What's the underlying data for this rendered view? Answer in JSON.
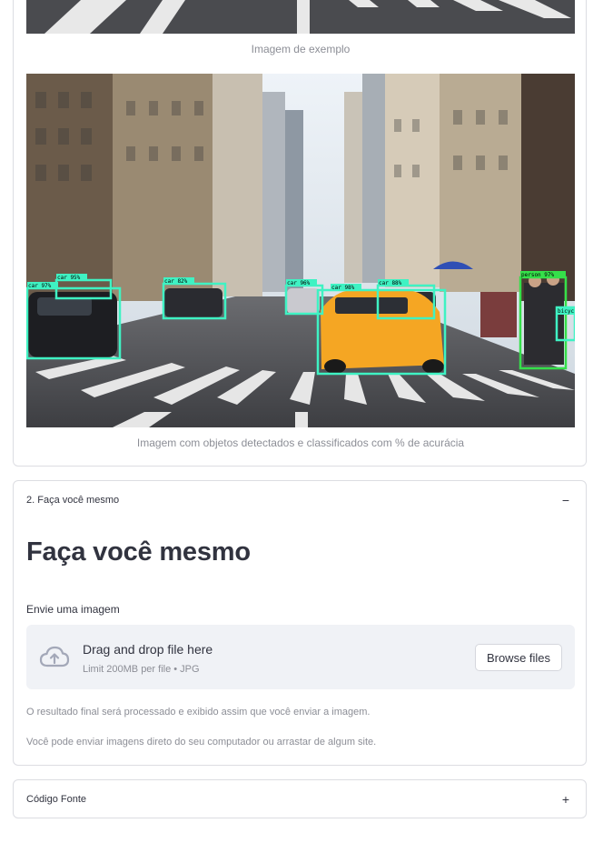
{
  "example_section": {
    "caption_top": "Imagem de exemplo",
    "caption_detected": "Imagem com objetos detectados e classificados com % de acurácia",
    "detections": [
      {
        "label": "car 97%",
        "color": "#3ff2c3"
      },
      {
        "label": "car 95%",
        "color": "#3ff2c3"
      },
      {
        "label": "car 82%",
        "color": "#3ff2c3"
      },
      {
        "label": "car 96%",
        "color": "#3ff2c3"
      },
      {
        "label": "car 98%",
        "color": "#3ff2c3"
      },
      {
        "label": "car 88%",
        "color": "#3ff2c3"
      },
      {
        "label": "person 97%",
        "color": "#35e04a"
      },
      {
        "label": "bicyc",
        "color": "#3ff2c3"
      }
    ]
  },
  "diy_section": {
    "expander_label": "2. Faça você mesmo",
    "expander_toggle": "−",
    "title": "Faça você mesmo",
    "upload_label": "Envie uma imagem",
    "dropzone_title": "Drag and drop file here",
    "dropzone_limits": "Limit 200MB per file • JPG",
    "browse_button": "Browse files",
    "info_1": "O resultado final será processado e exibido assim que você enviar a imagem.",
    "info_2": "Você pode enviar imagens direto do seu computador ou arrastar de algum site."
  },
  "source_section": {
    "expander_label": "Código Fonte",
    "expander_toggle": "+"
  },
  "colors": {
    "box_car": "#3ff2c3",
    "box_person": "#35e04a",
    "taxi": "#f5a623"
  }
}
